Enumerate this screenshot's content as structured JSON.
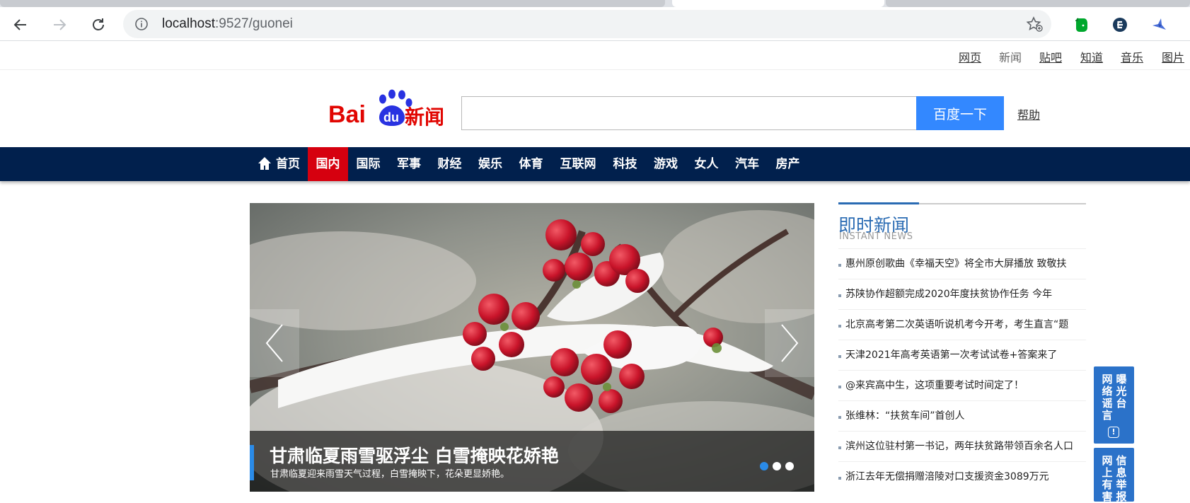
{
  "browser": {
    "url_host": "localhost",
    "url_rest": ":9527/guonei",
    "icons": [
      "back-icon",
      "forward-icon",
      "reload-icon",
      "info-icon",
      "bookmark-star-icon",
      "evernote-icon",
      "extension-e-icon",
      "extension-bird-icon"
    ]
  },
  "top_links": [
    "网页",
    "新闻",
    "贴吧",
    "知道",
    "音乐",
    "图片"
  ],
  "header": {
    "logo_bai": "Bai",
    "logo_du": "du",
    "logo_news": "新闻",
    "search_placeholder": "",
    "search_button": "百度一下",
    "help_link": "帮助"
  },
  "nav": {
    "home": "首页",
    "items": [
      "国内",
      "国际",
      "军事",
      "财经",
      "娱乐",
      "体育",
      "互联网",
      "科技",
      "游戏",
      "女人",
      "汽车",
      "房产"
    ],
    "active": "国内"
  },
  "carousel": {
    "title": "甘肃临夏雨雪驱浮尘 白雪掩映花娇艳",
    "desc": "甘肃临夏迎来雨雪天气过程，白雪掩映下，花朵更显娇艳。",
    "slide_count": 3,
    "active_slide": 1
  },
  "instant_news": {
    "title": "即时新闻",
    "subtitle": "INSTANT NEWS",
    "items": [
      "惠州原创歌曲《幸福天空》将全市大屏播放 致敬扶",
      "苏陕协作超额完成2020年度扶贫协作任务 今年",
      "北京高考第二次英语听说机考今开考，考生直言“题",
      "天津2021年高考英语第一次考试试卷+答案来了",
      "@来宾高中生，这项重要考试时间定了！",
      "张维林：“扶贫车间”首创人",
      "滨州这位驻村第一书记，两年扶贫路带领百余名人口",
      "浙江去年无偿捐赠涪陵对口支援资金3089万元"
    ]
  },
  "side_widgets": {
    "rumor": {
      "col1": "网络谣言",
      "col2": "曝光台"
    },
    "report": {
      "col1": "网上有害",
      "col2": "信息举报"
    }
  },
  "colors": {
    "nav_bg": "#01204d",
    "nav_active": "#d6000f",
    "search_button": "#3388ff",
    "news_title": "#2a6bb3",
    "side_widget": "#2b72c9"
  }
}
